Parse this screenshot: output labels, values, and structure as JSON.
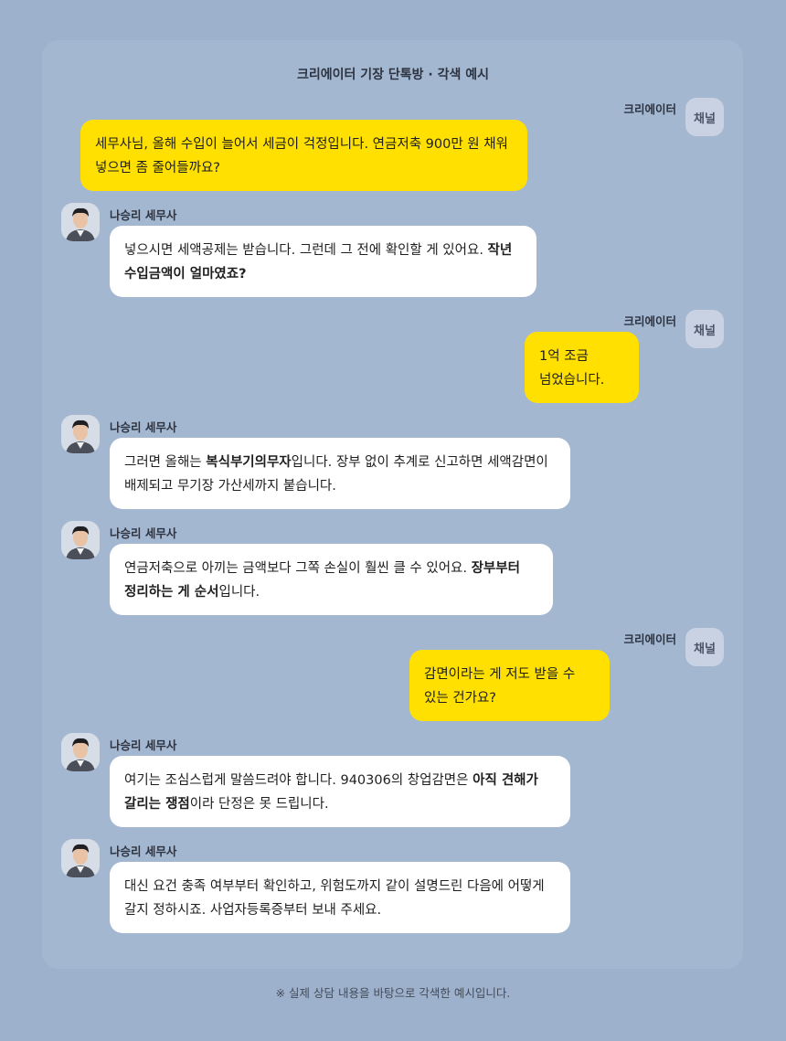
{
  "header": {
    "title": "크리에이터 기장 단톡방 · 각색 예시"
  },
  "participants": {
    "client_name": "크리에이터",
    "client_badge": "채널",
    "advisor_name": "나승리 세무사"
  },
  "messages": [
    {
      "from": "client",
      "text": "세무사님, 올해 수입이 늘어서 세금이 걱정입니다. 연금저축 900만 원 채워 넣으면 좀 줄어들까요?"
    },
    {
      "from": "advisor",
      "text_a": "넣으시면 세액공제는 받습니다. 그런데 그 전에 확인할 게 있어요. ",
      "bold": "작년 수입금액이 얼마였죠?",
      "text_b": ""
    },
    {
      "from": "client",
      "text": "1억 조금 넘었습니다."
    },
    {
      "from": "advisor",
      "text_a": "그러면 올해는 ",
      "bold": "복식부기의무자",
      "text_b": "입니다. 장부 없이 추계로 신고하면 세액감면이 배제되고 무기장 가산세까지 붙습니다."
    },
    {
      "from": "advisor",
      "text_a": "연금저축으로 아끼는 금액보다 그쪽 손실이 훨씬 클 수 있어요. ",
      "bold": "장부부터 정리하는 게 순서",
      "text_b": "입니다."
    },
    {
      "from": "client",
      "text": "감면이라는 게 저도 받을 수 있는 건가요?"
    },
    {
      "from": "advisor",
      "text_a": "여기는 조심스럽게 말씀드려야 합니다. 940306의 창업감면은 ",
      "bold": "아직 견해가 갈리는 쟁점",
      "text_b": "이라 단정은 못 드립니다."
    },
    {
      "from": "advisor",
      "text_a": "대신 요건 충족 여부부터 확인하고, 위험도까지 같이 설명드린 다음에 어떻게 갈지 정하시죠. 사업자등록증부터 보내 주세요.",
      "bold": "",
      "text_b": ""
    }
  ],
  "footer": {
    "note": "※ 실제 상담 내용을 바탕으로 각색한 예시입니다."
  },
  "colors": {
    "background": "#9db1cc",
    "panel": "#a3b7d1",
    "client_bubble": "#ffe000",
    "advisor_bubble": "#ffffff"
  },
  "icons": {
    "advisor_avatar": "advisor-portrait",
    "client_avatar": "channel-badge"
  }
}
